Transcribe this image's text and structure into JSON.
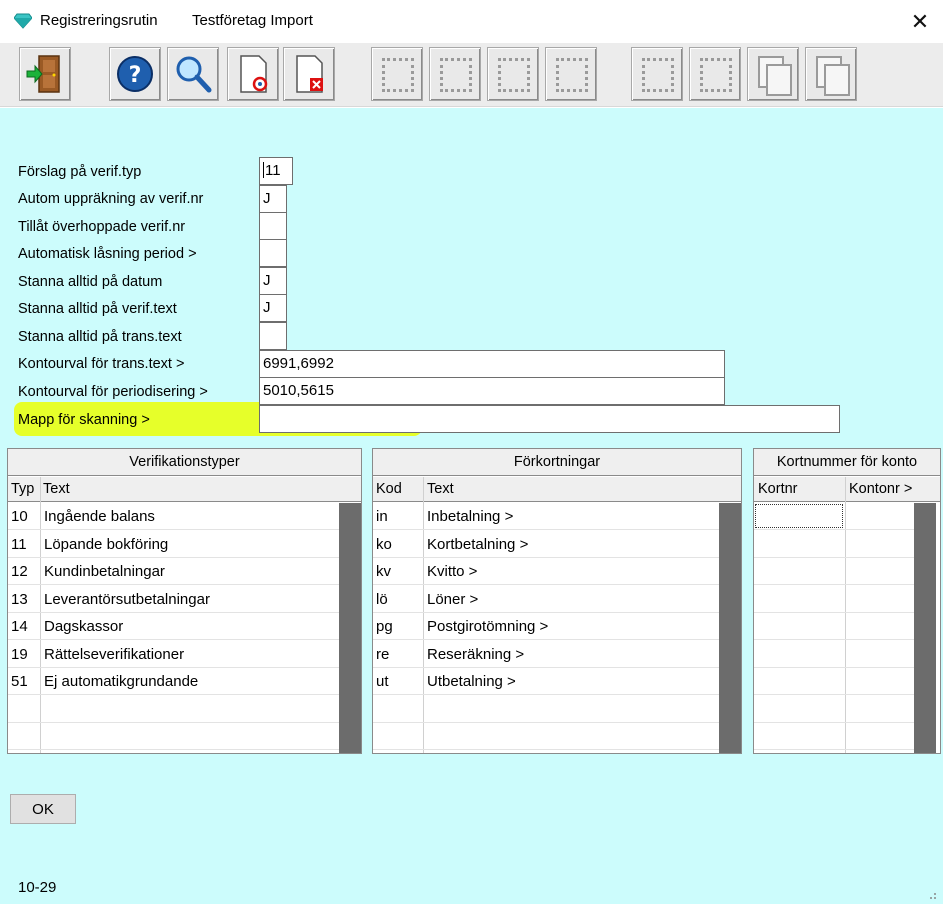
{
  "window": {
    "title": "Registreringsrutin",
    "company": "Testföretag Import",
    "close_glyph": "✕",
    "icon": "diamond-icon"
  },
  "toolbar": {
    "buttons": [
      {
        "name": "exit-door-icon",
        "enabled": true
      },
      {
        "name": "help-icon",
        "enabled": true
      },
      {
        "name": "search-icon",
        "enabled": true
      },
      {
        "name": "document-refresh-icon",
        "enabled": true
      },
      {
        "name": "document-delete-icon",
        "enabled": true
      },
      {
        "name": "blank-icon",
        "enabled": false
      },
      {
        "name": "blank-icon",
        "enabled": false
      },
      {
        "name": "blank-icon",
        "enabled": false
      },
      {
        "name": "blank-icon",
        "enabled": false
      },
      {
        "name": "blank-icon",
        "enabled": false
      },
      {
        "name": "blank-icon",
        "enabled": false
      },
      {
        "name": "copy-pages-icon",
        "enabled": false
      },
      {
        "name": "copy-pages-icon",
        "enabled": false
      }
    ]
  },
  "form": {
    "fields": [
      {
        "label": "Förslag på verif.typ",
        "value": "11"
      },
      {
        "label": "Autom uppräkning av verif.nr",
        "value": "J"
      },
      {
        "label": "Tillåt överhoppade verif.nr",
        "value": ""
      },
      {
        "label": "Automatisk låsning period >",
        "value": ""
      },
      {
        "label": "Stanna alltid på datum",
        "value": "J"
      },
      {
        "label": "Stanna alltid på verif.text",
        "value": "J"
      },
      {
        "label": "Stanna alltid på trans.text",
        "value": ""
      },
      {
        "label": "Kontourval för trans.text >",
        "value": "6991,6992"
      },
      {
        "label": "Kontourval för periodisering >",
        "value": "5010,5615"
      },
      {
        "label": "Mapp för skanning >",
        "value": ""
      }
    ],
    "highlight_color": "#e6ff2a"
  },
  "verifikationstyper": {
    "title": "Verifikationstyper",
    "columns": [
      "Typ",
      "Text"
    ],
    "rows": [
      [
        "10",
        "Ingående balans"
      ],
      [
        "11",
        "Löpande bokföring"
      ],
      [
        "12",
        "Kundinbetalningar"
      ],
      [
        "13",
        "Leverantörsutbetalningar"
      ],
      [
        "14",
        "Dagskassor"
      ],
      [
        "19",
        "Rättelseverifikationer"
      ],
      [
        "51",
        "Ej automatikgrundande"
      ],
      [
        "",
        ""
      ],
      [
        "",
        ""
      ]
    ]
  },
  "forkortningar": {
    "title": "Förkortningar",
    "columns": [
      "Kod",
      "Text"
    ],
    "rows": [
      [
        "in",
        "Inbetalning >"
      ],
      [
        "ko",
        "Kortbetalning >"
      ],
      [
        "kv",
        "Kvitto >"
      ],
      [
        "lö",
        "Löner >"
      ],
      [
        "pg",
        "Postgirotömning >"
      ],
      [
        "re",
        "Reseräkning >"
      ],
      [
        "ut",
        "Utbetalning >"
      ],
      [
        "",
        ""
      ],
      [
        "",
        ""
      ]
    ]
  },
  "kortnummer": {
    "title": "Kortnummer för konto",
    "columns": [
      "Kortnr",
      "Kontonr >"
    ],
    "rows": [
      [
        "",
        ""
      ],
      [
        "",
        ""
      ],
      [
        "",
        ""
      ],
      [
        "",
        ""
      ],
      [
        "",
        ""
      ],
      [
        "",
        ""
      ],
      [
        "",
        ""
      ],
      [
        "",
        ""
      ],
      [
        "",
        ""
      ]
    ]
  },
  "ok_label": "OK",
  "status_code": "10-29",
  "colors": {
    "background": "#ccfcfc",
    "scrollbar": "#6c6c6c"
  }
}
